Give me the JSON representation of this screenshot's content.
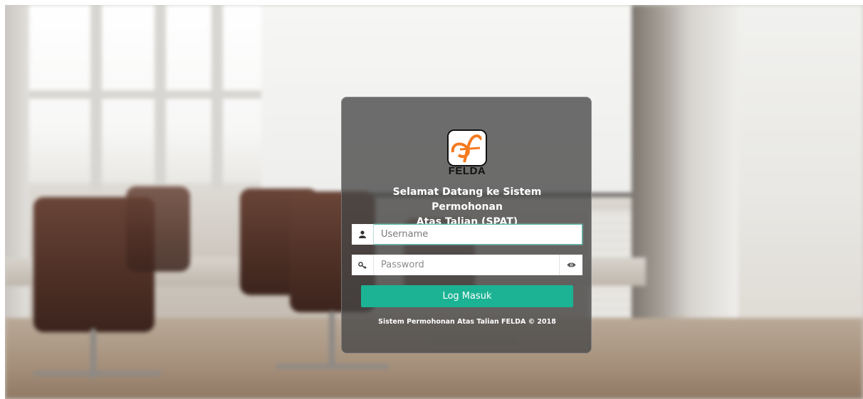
{
  "logo": {
    "brand_text": "FELDA",
    "icon": "felda-f-logo",
    "colors": {
      "accent": "#f47a20",
      "outline": "#111111"
    }
  },
  "login": {
    "welcome_line1": "Selamat Datang ke Sistem Permohonan",
    "welcome_line2": "Atas Talian (SPAT)",
    "username": {
      "value": "",
      "placeholder": "Username",
      "icon": "user-icon"
    },
    "password": {
      "value": "",
      "placeholder": "Password",
      "icon": "key-icon",
      "toggle_icon": "eye-icon"
    },
    "submit_label": "Log Masuk",
    "footer": "Sistem Permohonan Atas Talian FELDA © 2018"
  },
  "colors": {
    "primary_button": "#1bb394",
    "focus_border": "#5cc0b5",
    "card_background": "rgba(70,70,70,0.78)"
  }
}
